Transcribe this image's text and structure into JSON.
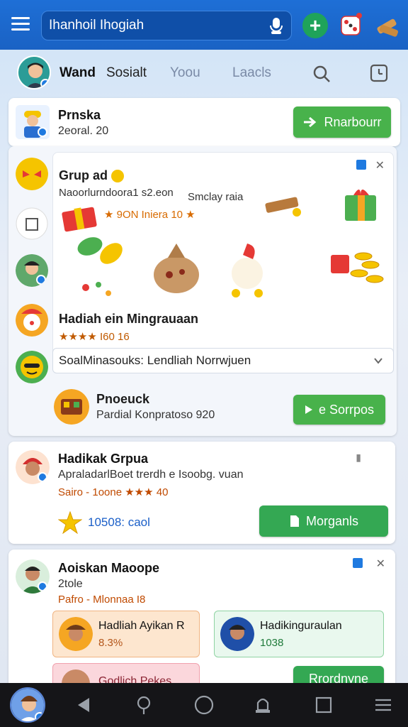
{
  "topbar": {
    "search_value": "Ihanhoil Ihogiah",
    "icons": [
      "menu-icon",
      "microphone-icon",
      "add-icon",
      "dice-icon",
      "wood-icon"
    ]
  },
  "tabs": {
    "wand": "Wand",
    "sosial": "Sosialt",
    "you": "Yoou",
    "loads": "Laacls"
  },
  "card1": {
    "title": "Prnska",
    "subtitle": "2eoral. 20",
    "button_label": "Rnarbourr"
  },
  "feed": {
    "group_title": "Grup ad",
    "group_line": "Naoorlurndoora1 s2.eon",
    "small_label": "Smclay raia",
    "promo_line": "★ 9ON Iniera 10 ★",
    "hadiah_title": "Hadiah ein Mingrauaan",
    "rating": "★★★★ I60 16",
    "dropdown_label": "SoalMinasouks: Lendliah Norrwjuen",
    "product_title": "Pnoeuck",
    "product_sub": "Pardial Konpratoso 920",
    "product_button": "e Sorrpos"
  },
  "card3": {
    "title": "Hadikak Grpua",
    "subtitle": "ApraladarlBoet trerdh e Isoobg. vuan",
    "meta": "Sairo - 1oone ★★★ 40",
    "count": "10508: caol",
    "button_label": "Morganls"
  },
  "card4": {
    "title": "Aoiskan Maoope",
    "subtitle": "2tole",
    "meta": "Pafro - Mlonnaa I8",
    "mini1_title": "Hadliah Ayikan R",
    "mini1_sub": "8.3%",
    "mini2_title": "Hadikinguraulan",
    "mini2_sub": "1038",
    "mini3_title": "Godlich Pekes",
    "button_label": "Rrordnyne"
  },
  "colors": {
    "topbar": "#1e6fd6",
    "accent_green": "#34a853",
    "navbar": "#151518"
  }
}
